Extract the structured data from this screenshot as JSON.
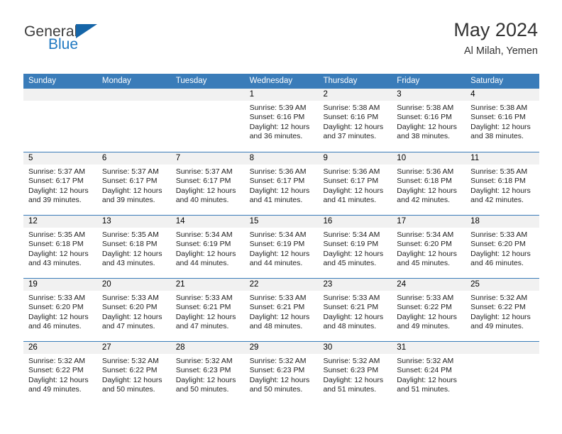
{
  "brand": {
    "name_top": "General",
    "name_bottom": "Blue",
    "accent_color": "#1f78c1",
    "triangle_color": "#1565a8"
  },
  "header": {
    "title": "May 2024",
    "subtitle": "Al Milah, Yemen"
  },
  "calendar": {
    "header_bg": "#3a7cb9",
    "daynum_bg": "#f1f1f1",
    "weekdays": [
      "Sunday",
      "Monday",
      "Tuesday",
      "Wednesday",
      "Thursday",
      "Friday",
      "Saturday"
    ],
    "weeks": [
      [
        {
          "day": "",
          "empty": true,
          "lines": []
        },
        {
          "day": "",
          "empty": true,
          "lines": []
        },
        {
          "day": "",
          "empty": true,
          "lines": []
        },
        {
          "day": "1",
          "empty": false,
          "lines": [
            "Sunrise: 5:39 AM",
            "Sunset: 6:16 PM",
            "Daylight: 12 hours",
            "and 36 minutes."
          ]
        },
        {
          "day": "2",
          "empty": false,
          "lines": [
            "Sunrise: 5:38 AM",
            "Sunset: 6:16 PM",
            "Daylight: 12 hours",
            "and 37 minutes."
          ]
        },
        {
          "day": "3",
          "empty": false,
          "lines": [
            "Sunrise: 5:38 AM",
            "Sunset: 6:16 PM",
            "Daylight: 12 hours",
            "and 38 minutes."
          ]
        },
        {
          "day": "4",
          "empty": false,
          "lines": [
            "Sunrise: 5:38 AM",
            "Sunset: 6:16 PM",
            "Daylight: 12 hours",
            "and 38 minutes."
          ]
        }
      ],
      [
        {
          "day": "5",
          "empty": false,
          "lines": [
            "Sunrise: 5:37 AM",
            "Sunset: 6:17 PM",
            "Daylight: 12 hours",
            "and 39 minutes."
          ]
        },
        {
          "day": "6",
          "empty": false,
          "lines": [
            "Sunrise: 5:37 AM",
            "Sunset: 6:17 PM",
            "Daylight: 12 hours",
            "and 39 minutes."
          ]
        },
        {
          "day": "7",
          "empty": false,
          "lines": [
            "Sunrise: 5:37 AM",
            "Sunset: 6:17 PM",
            "Daylight: 12 hours",
            "and 40 minutes."
          ]
        },
        {
          "day": "8",
          "empty": false,
          "lines": [
            "Sunrise: 5:36 AM",
            "Sunset: 6:17 PM",
            "Daylight: 12 hours",
            "and 41 minutes."
          ]
        },
        {
          "day": "9",
          "empty": false,
          "lines": [
            "Sunrise: 5:36 AM",
            "Sunset: 6:17 PM",
            "Daylight: 12 hours",
            "and 41 minutes."
          ]
        },
        {
          "day": "10",
          "empty": false,
          "lines": [
            "Sunrise: 5:36 AM",
            "Sunset: 6:18 PM",
            "Daylight: 12 hours",
            "and 42 minutes."
          ]
        },
        {
          "day": "11",
          "empty": false,
          "lines": [
            "Sunrise: 5:35 AM",
            "Sunset: 6:18 PM",
            "Daylight: 12 hours",
            "and 42 minutes."
          ]
        }
      ],
      [
        {
          "day": "12",
          "empty": false,
          "lines": [
            "Sunrise: 5:35 AM",
            "Sunset: 6:18 PM",
            "Daylight: 12 hours",
            "and 43 minutes."
          ]
        },
        {
          "day": "13",
          "empty": false,
          "lines": [
            "Sunrise: 5:35 AM",
            "Sunset: 6:18 PM",
            "Daylight: 12 hours",
            "and 43 minutes."
          ]
        },
        {
          "day": "14",
          "empty": false,
          "lines": [
            "Sunrise: 5:34 AM",
            "Sunset: 6:19 PM",
            "Daylight: 12 hours",
            "and 44 minutes."
          ]
        },
        {
          "day": "15",
          "empty": false,
          "lines": [
            "Sunrise: 5:34 AM",
            "Sunset: 6:19 PM",
            "Daylight: 12 hours",
            "and 44 minutes."
          ]
        },
        {
          "day": "16",
          "empty": false,
          "lines": [
            "Sunrise: 5:34 AM",
            "Sunset: 6:19 PM",
            "Daylight: 12 hours",
            "and 45 minutes."
          ]
        },
        {
          "day": "17",
          "empty": false,
          "lines": [
            "Sunrise: 5:34 AM",
            "Sunset: 6:20 PM",
            "Daylight: 12 hours",
            "and 45 minutes."
          ]
        },
        {
          "day": "18",
          "empty": false,
          "lines": [
            "Sunrise: 5:33 AM",
            "Sunset: 6:20 PM",
            "Daylight: 12 hours",
            "and 46 minutes."
          ]
        }
      ],
      [
        {
          "day": "19",
          "empty": false,
          "lines": [
            "Sunrise: 5:33 AM",
            "Sunset: 6:20 PM",
            "Daylight: 12 hours",
            "and 46 minutes."
          ]
        },
        {
          "day": "20",
          "empty": false,
          "lines": [
            "Sunrise: 5:33 AM",
            "Sunset: 6:20 PM",
            "Daylight: 12 hours",
            "and 47 minutes."
          ]
        },
        {
          "day": "21",
          "empty": false,
          "lines": [
            "Sunrise: 5:33 AM",
            "Sunset: 6:21 PM",
            "Daylight: 12 hours",
            "and 47 minutes."
          ]
        },
        {
          "day": "22",
          "empty": false,
          "lines": [
            "Sunrise: 5:33 AM",
            "Sunset: 6:21 PM",
            "Daylight: 12 hours",
            "and 48 minutes."
          ]
        },
        {
          "day": "23",
          "empty": false,
          "lines": [
            "Sunrise: 5:33 AM",
            "Sunset: 6:21 PM",
            "Daylight: 12 hours",
            "and 48 minutes."
          ]
        },
        {
          "day": "24",
          "empty": false,
          "lines": [
            "Sunrise: 5:33 AM",
            "Sunset: 6:22 PM",
            "Daylight: 12 hours",
            "and 49 minutes."
          ]
        },
        {
          "day": "25",
          "empty": false,
          "lines": [
            "Sunrise: 5:32 AM",
            "Sunset: 6:22 PM",
            "Daylight: 12 hours",
            "and 49 minutes."
          ]
        }
      ],
      [
        {
          "day": "26",
          "empty": false,
          "lines": [
            "Sunrise: 5:32 AM",
            "Sunset: 6:22 PM",
            "Daylight: 12 hours",
            "and 49 minutes."
          ]
        },
        {
          "day": "27",
          "empty": false,
          "lines": [
            "Sunrise: 5:32 AM",
            "Sunset: 6:22 PM",
            "Daylight: 12 hours",
            "and 50 minutes."
          ]
        },
        {
          "day": "28",
          "empty": false,
          "lines": [
            "Sunrise: 5:32 AM",
            "Sunset: 6:23 PM",
            "Daylight: 12 hours",
            "and 50 minutes."
          ]
        },
        {
          "day": "29",
          "empty": false,
          "lines": [
            "Sunrise: 5:32 AM",
            "Sunset: 6:23 PM",
            "Daylight: 12 hours",
            "and 50 minutes."
          ]
        },
        {
          "day": "30",
          "empty": false,
          "lines": [
            "Sunrise: 5:32 AM",
            "Sunset: 6:23 PM",
            "Daylight: 12 hours",
            "and 51 minutes."
          ]
        },
        {
          "day": "31",
          "empty": false,
          "lines": [
            "Sunrise: 5:32 AM",
            "Sunset: 6:24 PM",
            "Daylight: 12 hours",
            "and 51 minutes."
          ]
        },
        {
          "day": "",
          "empty": true,
          "lines": []
        }
      ]
    ]
  }
}
